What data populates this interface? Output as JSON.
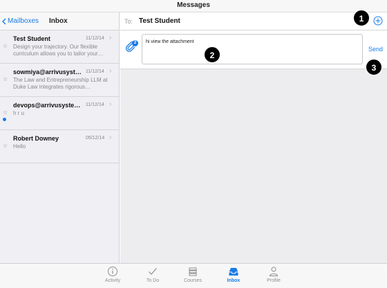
{
  "status_bar": {
    "title": "Messages"
  },
  "left_pane": {
    "back_label": "Mailboxes",
    "title": "Inbox",
    "messages": [
      {
        "sender": "Test Student",
        "date": "11/12/14",
        "preview": "Design your trajectory. Our flexible curriculum allows you to tailor your…",
        "unread": false
      },
      {
        "sender": "sowmiya@arrivusyst…",
        "date": "11/12/14",
        "preview": "The Law and Entrepreneurship LLM at Duke Law integrates rigorous…",
        "unread": false
      },
      {
        "sender": "devops@arrivusyste…",
        "date": "11/12/14",
        "preview": "h r u",
        "unread": true
      },
      {
        "sender": "Robert Downey",
        "date": "05/12/14",
        "preview": "Hello",
        "unread": false
      }
    ]
  },
  "compose": {
    "to_label": "To:",
    "to_value": "Test Student",
    "attachment_count": "2",
    "body": "hi view the attachment",
    "send_label": "Send"
  },
  "callouts": [
    "1",
    "2",
    "3"
  ],
  "tabs": [
    {
      "label": "Activity",
      "icon": "info-circle-icon",
      "active": false
    },
    {
      "label": "To Do",
      "icon": "checkmark-icon",
      "active": false
    },
    {
      "label": "Courses",
      "icon": "books-icon",
      "active": false
    },
    {
      "label": "Inbox",
      "icon": "inbox-tray-icon",
      "active": true
    },
    {
      "label": "Profile",
      "icon": "person-icon",
      "active": false
    }
  ],
  "colors": {
    "accent": "#1a7be6",
    "callout": "#000000"
  }
}
